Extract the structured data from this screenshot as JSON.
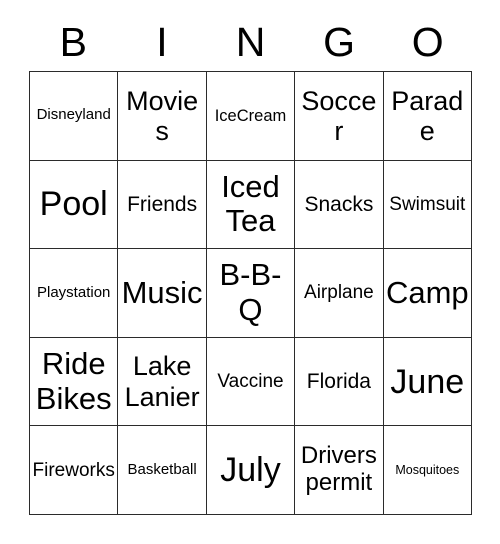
{
  "card": {
    "title": "Bingo Card",
    "header_letters": [
      "B",
      "I",
      "N",
      "G",
      "O"
    ],
    "colors": {
      "background": "#ffffff",
      "cell_background": "#ffffff",
      "border": "#2b2b2b",
      "text": "#000000"
    },
    "grid": {
      "columns": 5,
      "rows": 5,
      "rows_data": [
        {
          "cells": [
            {
              "text": "Disneyland",
              "size": "fs-s"
            },
            {
              "text": "Movies",
              "size": "fs-xl"
            },
            {
              "text": "IceCream",
              "size": "fs-sm"
            },
            {
              "text": "Soccer",
              "size": "fs-xl"
            },
            {
              "text": "Parade",
              "size": "fs-xl"
            }
          ]
        },
        {
          "cells": [
            {
              "text": "Pool",
              "size": "fs-3xl"
            },
            {
              "text": "Friends",
              "size": "fs-ml"
            },
            {
              "text": "Iced Tea",
              "size": "fs-xxl"
            },
            {
              "text": "Snacks",
              "size": "fs-ml"
            },
            {
              "text": "Swimsuit",
              "size": "fs-m"
            }
          ]
        },
        {
          "cells": [
            {
              "text": "Playstation",
              "size": "fs-s"
            },
            {
              "text": "Music",
              "size": "fs-xxl"
            },
            {
              "text": "B-B-Q",
              "size": "fs-xxl"
            },
            {
              "text": "Airplane",
              "size": "fs-m"
            },
            {
              "text": "Camp",
              "size": "fs-xxl"
            }
          ]
        },
        {
          "cells": [
            {
              "text": "Ride Bikes",
              "size": "fs-xxl"
            },
            {
              "text": "Lake Lanier",
              "size": "fs-xl"
            },
            {
              "text": "Vaccine",
              "size": "fs-m"
            },
            {
              "text": "Florida",
              "size": "fs-ml"
            },
            {
              "text": "June",
              "size": "fs-3xl"
            }
          ]
        },
        {
          "cells": [
            {
              "text": "Fireworks",
              "size": "fs-m"
            },
            {
              "text": "Basketball",
              "size": "fs-s"
            },
            {
              "text": "July",
              "size": "fs-3xl"
            },
            {
              "text": "Drivers permit",
              "size": "fs-l"
            },
            {
              "text": "Mosquitoes",
              "size": "fs-xs"
            }
          ]
        }
      ]
    }
  }
}
